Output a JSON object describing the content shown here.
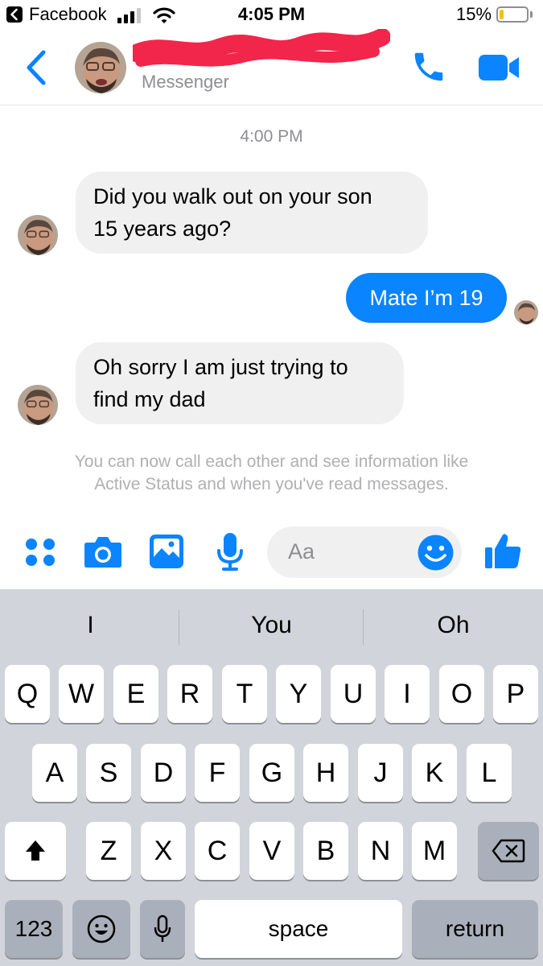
{
  "status_bar": {
    "back_app": "Facebook",
    "time": "4:05 PM",
    "battery_percent": "15%",
    "battery_level": 0.15
  },
  "header": {
    "subtitle": "Messenger",
    "accent_color": "#0a84ff",
    "icons": [
      "back-chevron-icon",
      "phone-icon",
      "video-camera-icon"
    ]
  },
  "chat": {
    "timestamp": "4:00 PM",
    "messages": [
      {
        "direction": "incoming",
        "lines": [
          "Did you walk out on your son",
          "15 years ago?"
        ]
      },
      {
        "direction": "outgoing",
        "lines": [
          "Mate I’m 19"
        ]
      },
      {
        "direction": "incoming",
        "lines": [
          "Oh sorry I am just trying to",
          "find my dad"
        ]
      }
    ],
    "info": [
      "You can now call each other and see information like",
      "Active Status and when you've read messages."
    ]
  },
  "composer": {
    "placeholder": "Aa",
    "icons": [
      "apps-icon",
      "camera-icon",
      "image-icon",
      "microphone-icon",
      "emoji-icon",
      "thumbs-up-icon"
    ]
  },
  "keyboard": {
    "suggestions": [
      "I",
      "You",
      "Oh"
    ],
    "row1": [
      "Q",
      "W",
      "E",
      "R",
      "T",
      "Y",
      "U",
      "I",
      "O",
      "P"
    ],
    "row2": [
      "A",
      "S",
      "D",
      "F",
      "G",
      "H",
      "J",
      "K",
      "L"
    ],
    "row3": [
      "Z",
      "X",
      "C",
      "V",
      "B",
      "N",
      "M"
    ],
    "numbers_key": "123",
    "space_key": "space",
    "return_key": "return"
  }
}
